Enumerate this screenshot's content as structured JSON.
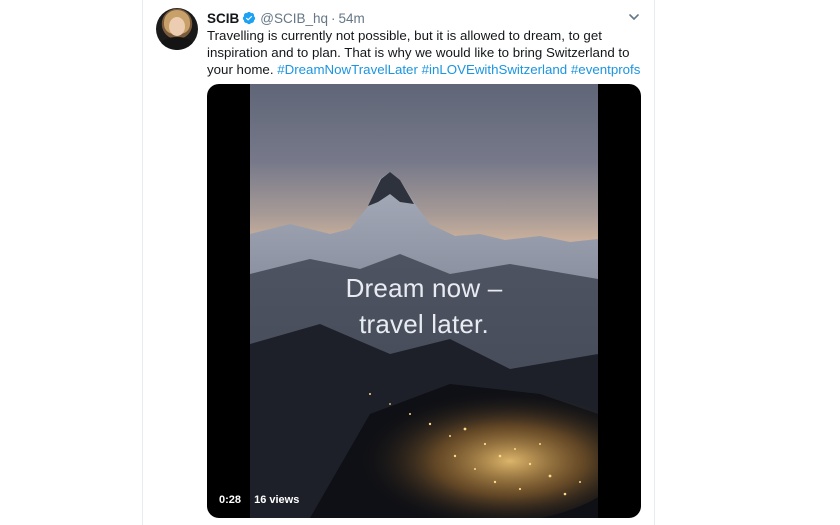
{
  "tweet": {
    "author_name": "SCIB",
    "handle": "@SCIB_hq",
    "separator": "·",
    "timestamp": "54m",
    "text_plain": "Travelling is currently not possible, but it is allowed to dream, to get inspiration and to plan. That is why we would like to bring Switzerland to your home.",
    "hashtags": [
      "#DreamNowTravelLater",
      "#inLOVEwithSwitzerland",
      "#eventprofs"
    ]
  },
  "video": {
    "overlay_line1": "Dream now –",
    "overlay_line2": "travel later.",
    "duration": "0:28",
    "views": "16 views"
  },
  "icons": {
    "verified": "verified-badge-icon",
    "caret": "chevron-down-icon"
  },
  "colors": {
    "link": "#1b95e0",
    "verified": "#1da1f2",
    "muted": "#657786"
  }
}
